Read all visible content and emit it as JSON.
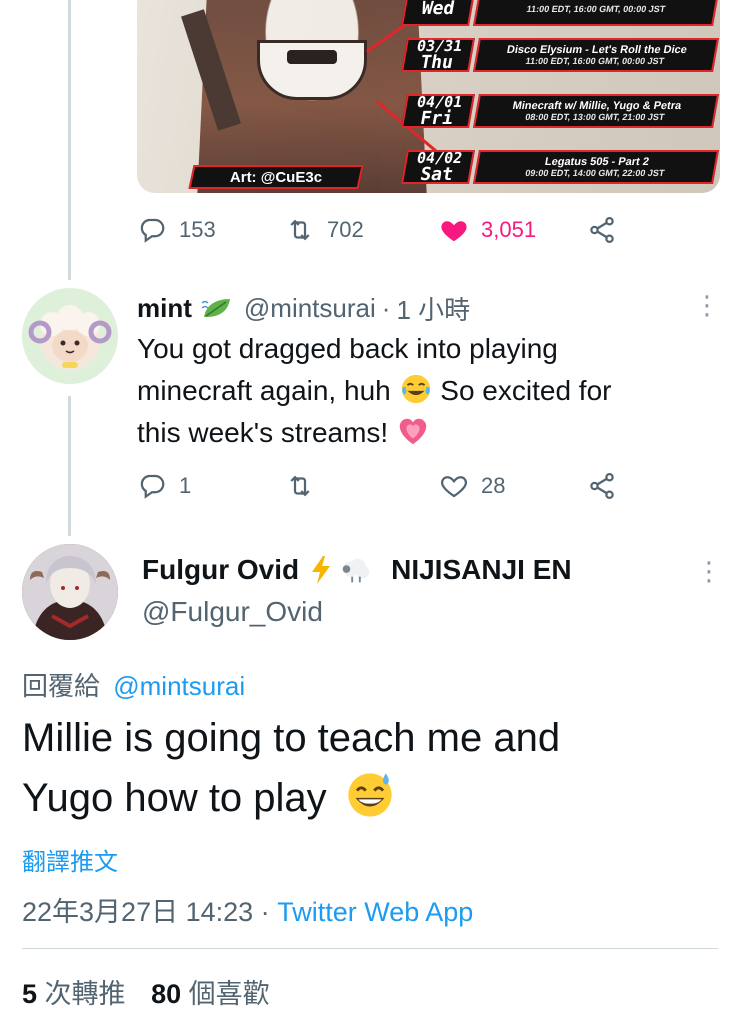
{
  "schedule_image": {
    "credit": "Art: @CuE3c",
    "rows": [
      {
        "date": "",
        "weekday": "Wed",
        "title": "",
        "times": "11:00 EDT, 16:00 GMT, 00:00 JST"
      },
      {
        "date": "03/31",
        "weekday": "Thu",
        "title": "Disco Elysium - Let's Roll the Dice",
        "times": "11:00 EDT, 16:00 GMT, 00:00 JST"
      },
      {
        "date": "04/01",
        "weekday": "Fri",
        "title": "Minecraft w/ Millie, Yugo & Petra",
        "times": "08:00 EDT, 13:00 GMT, 21:00 JST"
      },
      {
        "date": "04/02",
        "weekday": "Sat",
        "title": "Legatus 505 - Part 2",
        "times": "09:00 EDT, 14:00 GMT, 22:00 JST"
      }
    ]
  },
  "parent_actions": {
    "replies": "153",
    "retweets": "702",
    "likes": "3,051"
  },
  "reply": {
    "name": "mint",
    "handle": "@mintsurai",
    "time": "1 小時",
    "text_1": "You got dragged back into playing",
    "text_2": "minecraft again, huh",
    "text_3": "So excited for",
    "text_4": "this week's streams!",
    "actions": {
      "replies": "1",
      "retweets": "",
      "likes": "28"
    }
  },
  "main": {
    "name": "Fulgur Ovid",
    "org": "NIJISANJI EN",
    "handle": "@Fulgur_Ovid",
    "replying_prefix": "回覆給",
    "replying_to": "@mintsurai",
    "text_1": "Millie is going to teach me and",
    "text_2": "Yugo how to play",
    "translate": "翻譯推文",
    "timestamp": "22年3月27日 14:23",
    "separator": "·",
    "source": "Twitter Web App",
    "retweet_count": "5",
    "retweet_label": "次轉推",
    "like_count": "80",
    "like_label": "個喜歡"
  },
  "colors": {
    "accent": "#1d9bf0",
    "like": "#f91880",
    "muted": "#536471",
    "schedule_red": "#e0262b"
  }
}
